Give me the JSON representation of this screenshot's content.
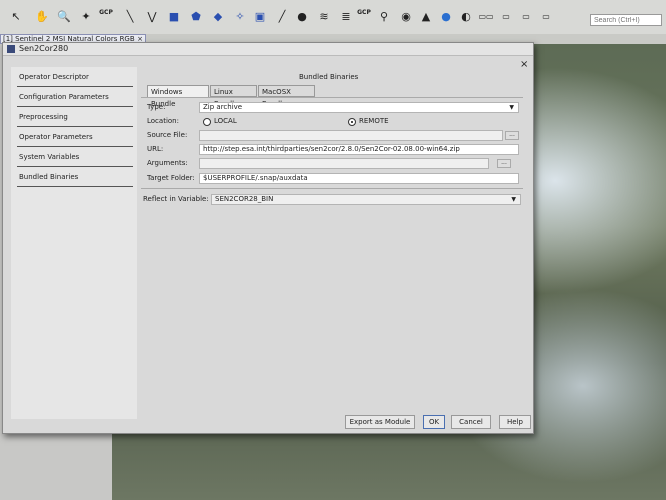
{
  "toolbar": {
    "gcp_label_1": "GCP",
    "gcp_label_2": "GCP",
    "search_placeholder": "Search (Ctrl+I)"
  },
  "view_tab": {
    "label": "[1] Sentinel 2 MSI Natural Colors RGB",
    "close": "×"
  },
  "dialog": {
    "title": "Sen2Cor280",
    "close": "×",
    "content_title": "Bundled Binaries",
    "sidebar": [
      "Operator Descriptor",
      "Configuration Parameters",
      "Preprocessing",
      "Operator Parameters",
      "System Variables",
      "Bundled Binaries"
    ],
    "tabs": [
      "Windows Bundle",
      "Linux Bundle",
      "MacOSX Bundle"
    ],
    "form": {
      "type_label": "Type:",
      "type_value": "Zip archive",
      "location_label": "Location:",
      "local_label": "LOCAL",
      "remote_label": "REMOTE",
      "source_label": "Source File:",
      "url_label": "URL:",
      "url_value": "http://step.esa.int/thirdparties/sen2cor/2.8.0/Sen2Cor-02.08.00-win64.zip",
      "arguments_label": "Arguments:",
      "browse": "...",
      "target_label": "Target Folder:",
      "target_value": "$USERPROFILE/.snap/auxdata"
    },
    "reflect_label": "Reflect in Variable:",
    "reflect_value": "SEN2COR28_BIN",
    "buttons": {
      "export": "Export as Module",
      "ok": "OK",
      "cancel": "Cancel",
      "help": "Help"
    }
  }
}
